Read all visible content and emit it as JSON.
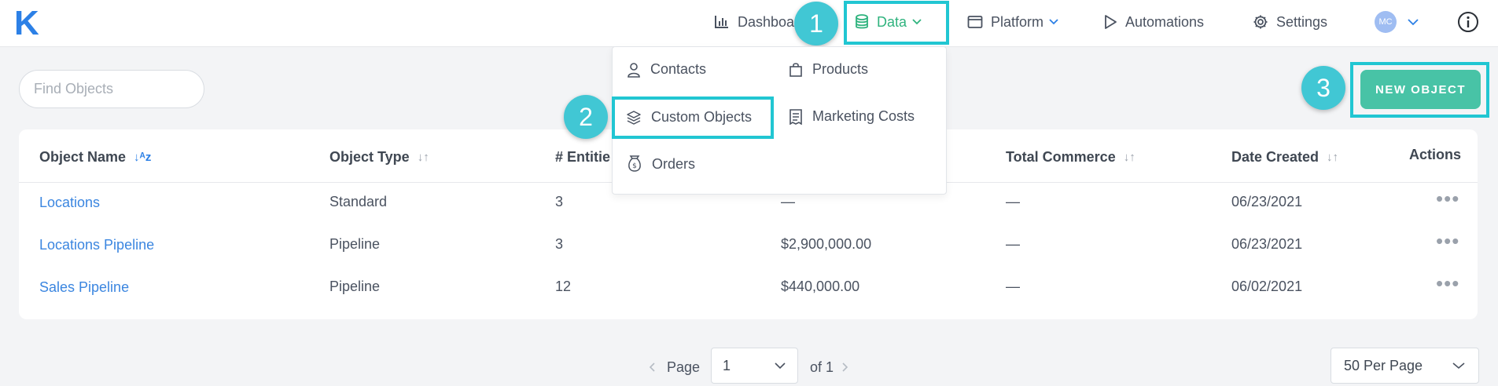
{
  "app": {
    "logo_text": "K",
    "brand_color": "#2c80e6"
  },
  "nav": {
    "dashboard": "Dashboard",
    "data": "Data",
    "platform": "Platform",
    "automations": "Automations",
    "settings": "Settings",
    "avatar_initials": "MC"
  },
  "data_menu": {
    "contacts": "Contacts",
    "products": "Products",
    "custom_objects": "Custom Objects",
    "marketing_costs": "Marketing Costs",
    "orders": "Orders"
  },
  "callouts": {
    "one": "1",
    "two": "2",
    "three": "3"
  },
  "search": {
    "placeholder": "Find Objects"
  },
  "new_object_button": "NEW OBJECT",
  "table": {
    "headers": {
      "object_name": "Object Name",
      "object_type": "Object Type",
      "entities": "# Entitie",
      "total_commerce": "Total Commerce",
      "date_created": "Date Created",
      "actions": "Actions"
    },
    "rows": [
      {
        "name": "Locations",
        "type": "Standard",
        "entities": "3",
        "value": "—",
        "commerce": "—",
        "date": "06/23/2021"
      },
      {
        "name": "Locations Pipeline",
        "type": "Pipeline",
        "entities": "3",
        "value": "$2,900,000.00",
        "commerce": "—",
        "date": "06/23/2021"
      },
      {
        "name": "Sales Pipeline",
        "type": "Pipeline",
        "entities": "12",
        "value": "$440,000.00",
        "commerce": "—",
        "date": "06/02/2021"
      }
    ]
  },
  "pagination": {
    "page_label": "Page",
    "current_page": "1",
    "of_label": "of 1",
    "per_page": "50 Per Page"
  },
  "colors": {
    "highlight": "#21c6d2",
    "active_nav": "#2fb37e",
    "primary_button": "#48c3a6",
    "link": "#3b86e0"
  }
}
